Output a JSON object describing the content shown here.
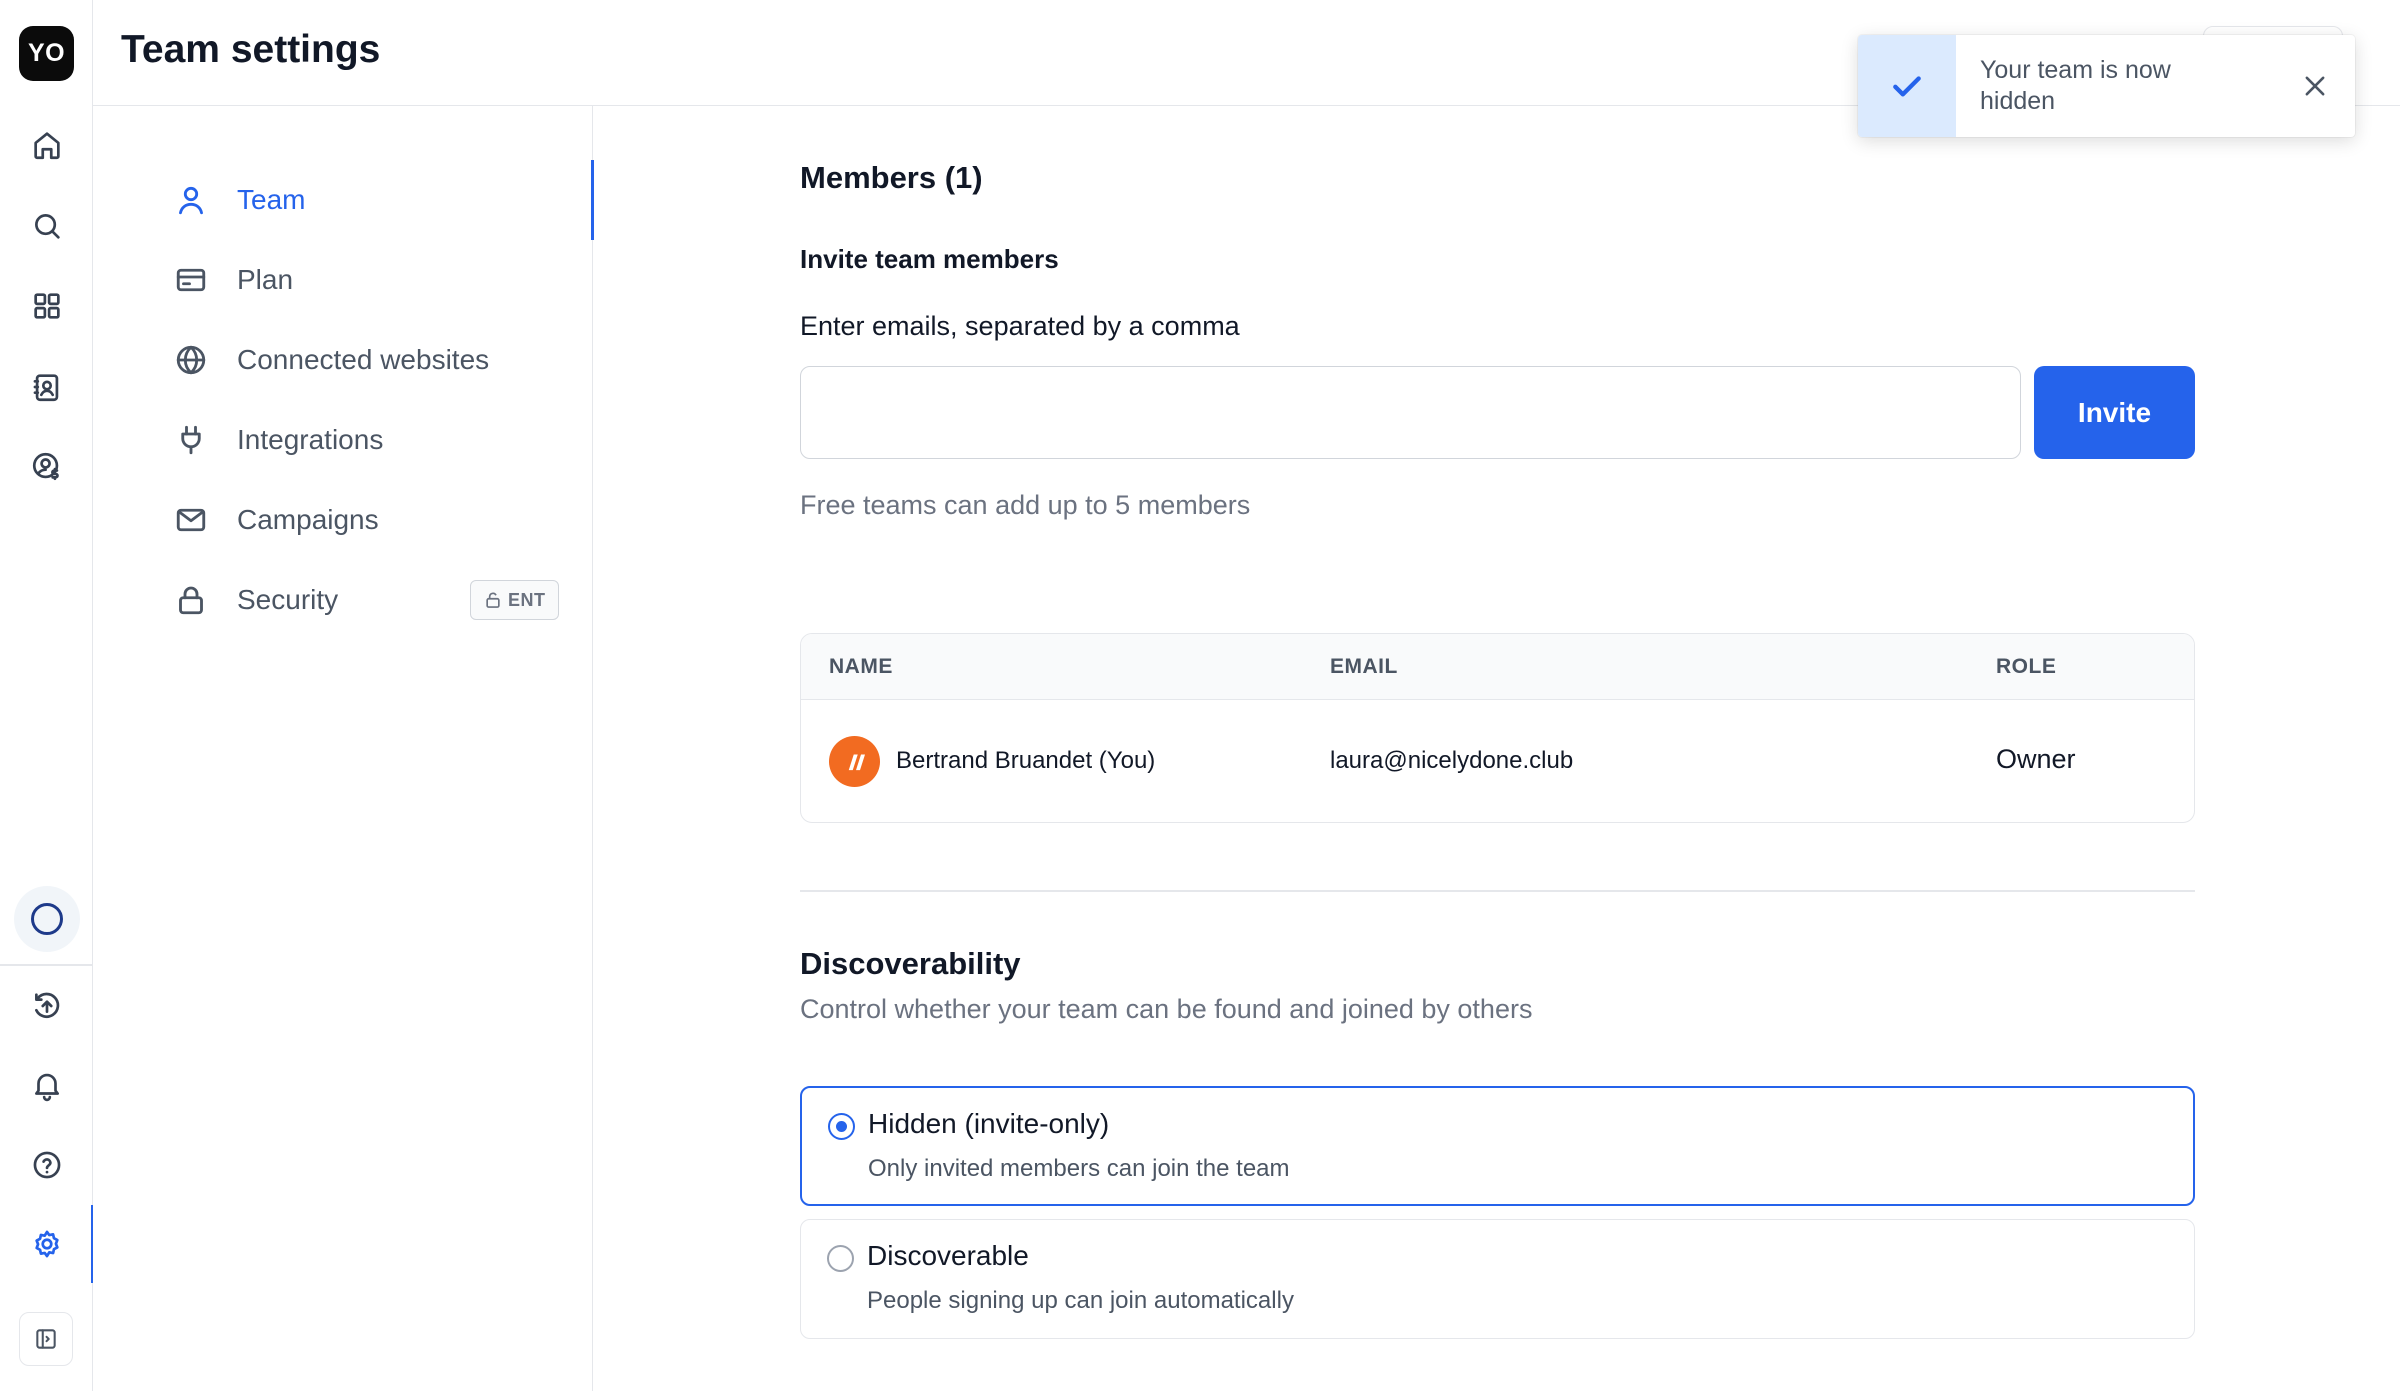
{
  "app": {
    "logo_text": "YO"
  },
  "header": {
    "title": "Team settings"
  },
  "rail": {
    "top_icons": [
      "home-icon",
      "search-icon",
      "grid-icon",
      "contacts-icon",
      "user-dollar-icon"
    ],
    "bottom_icons": [
      "upload-circle-icon",
      "bell-icon",
      "help-icon",
      "settings-icon",
      "sidebar-toggle-icon"
    ],
    "active": "settings-icon"
  },
  "settings_nav": {
    "items": [
      {
        "label": "Team",
        "icon": "user-icon",
        "active": true
      },
      {
        "label": "Plan",
        "icon": "credit-card-icon",
        "active": false
      },
      {
        "label": "Connected websites",
        "icon": "globe-icon",
        "active": false
      },
      {
        "label": "Integrations",
        "icon": "plug-icon",
        "active": false
      },
      {
        "label": "Campaigns",
        "icon": "mail-icon",
        "active": false
      },
      {
        "label": "Security",
        "icon": "lock-icon",
        "active": false,
        "badge": "ENT"
      }
    ]
  },
  "members": {
    "heading": "Members (1)",
    "invite_heading": "Invite team members",
    "input_label": "Enter emails, separated by a comma",
    "input_value": "",
    "invite_button": "Invite",
    "hint": "Free teams can add up to 5 members",
    "table": {
      "columns": [
        "NAME",
        "EMAIL",
        "ROLE"
      ],
      "rows": [
        {
          "name": "Bertrand Bruandet (You)",
          "email": "laura@nicelydone.club",
          "role": "Owner"
        }
      ]
    }
  },
  "discoverability": {
    "heading": "Discoverability",
    "subtitle": "Control whether your team can be found and joined by others",
    "options": [
      {
        "title": "Hidden (invite-only)",
        "description": "Only invited members can join the team",
        "selected": true
      },
      {
        "title": "Discoverable",
        "description": "People signing up can join automatically",
        "selected": false
      }
    ]
  },
  "toast": {
    "message": "Your team is now hidden"
  },
  "colors": {
    "accent": "#2563eb",
    "avatar": "#f26b21",
    "toast_bg": "#dbeafe"
  }
}
